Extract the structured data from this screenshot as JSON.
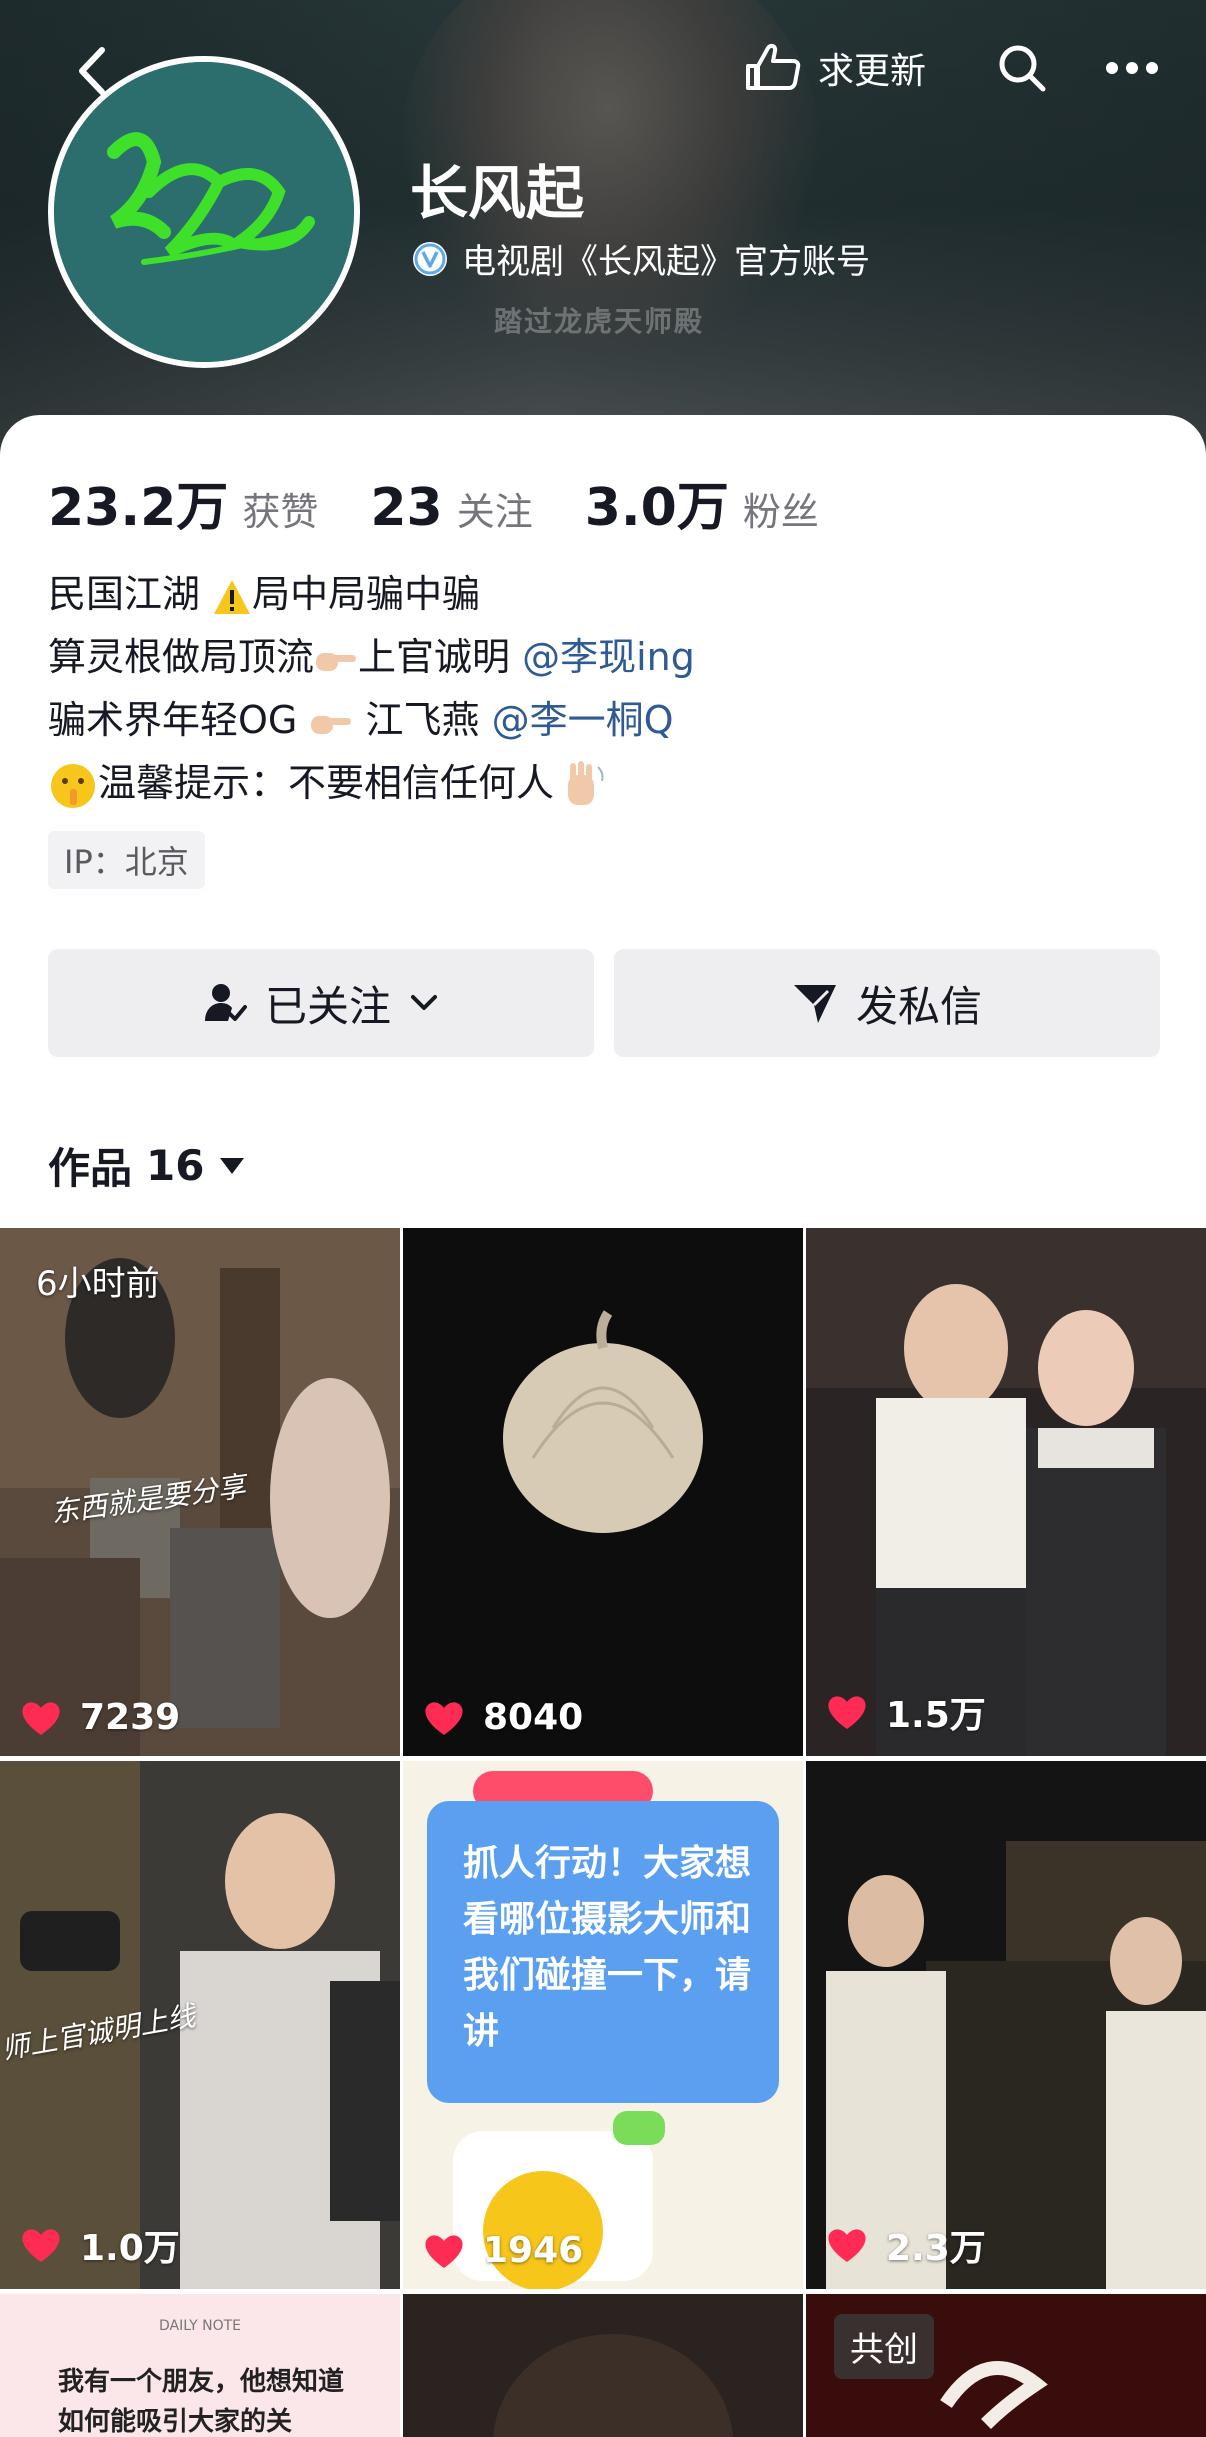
{
  "header": {
    "profile_name": "长风起",
    "verify_text": "电视剧《长风起》官方账号",
    "update_label": "求更新",
    "banner_caption": "踏过龙虎天师殿"
  },
  "stats": [
    {
      "value": "23.2万",
      "label": "获赞"
    },
    {
      "value": "23",
      "label": "关注"
    },
    {
      "value": "3.0万",
      "label": "粉丝"
    }
  ],
  "bio": {
    "line1": "民国江湖 ",
    "line1b": "局中局骗中骗",
    "line2": "算灵根做局顶流",
    "line2b": "上官诚明 ",
    "line2_mention": "@李现ing",
    "line3": "骗术界年轻OG ",
    "line3b": " 江飞燕 ",
    "line3_mention": "@李一桐Q",
    "line4": "温馨提示：不要相信任何人"
  },
  "ip_tag": "IP：北京",
  "buttons": {
    "follow_label": "已关注",
    "message_label": "发私信"
  },
  "works": {
    "label": "作品",
    "count": "16"
  },
  "tiles": [
    {
      "likes": "7239",
      "badge": "6小时前",
      "overlay": "东西就是要分享"
    },
    {
      "likes": "8040"
    },
    {
      "likes": "1.5万"
    },
    {
      "likes": "1.0万",
      "overlay": "师上官诚明上线"
    },
    {
      "likes": "1946",
      "overlay": "抓人行动！大家想看哪位摄影大师和我们碰撞一下，请讲"
    },
    {
      "likes": "2.3万"
    },
    {
      "overlay_top": "DAILY NOTE",
      "overlay": "我有一个朋友，他想知道如何能吸引大家的关"
    },
    {},
    {
      "badge": "共创"
    }
  ],
  "colors": {
    "like_heart": "#fe2c55",
    "mention": "#2e5a96",
    "verify": "#5da9e9"
  }
}
